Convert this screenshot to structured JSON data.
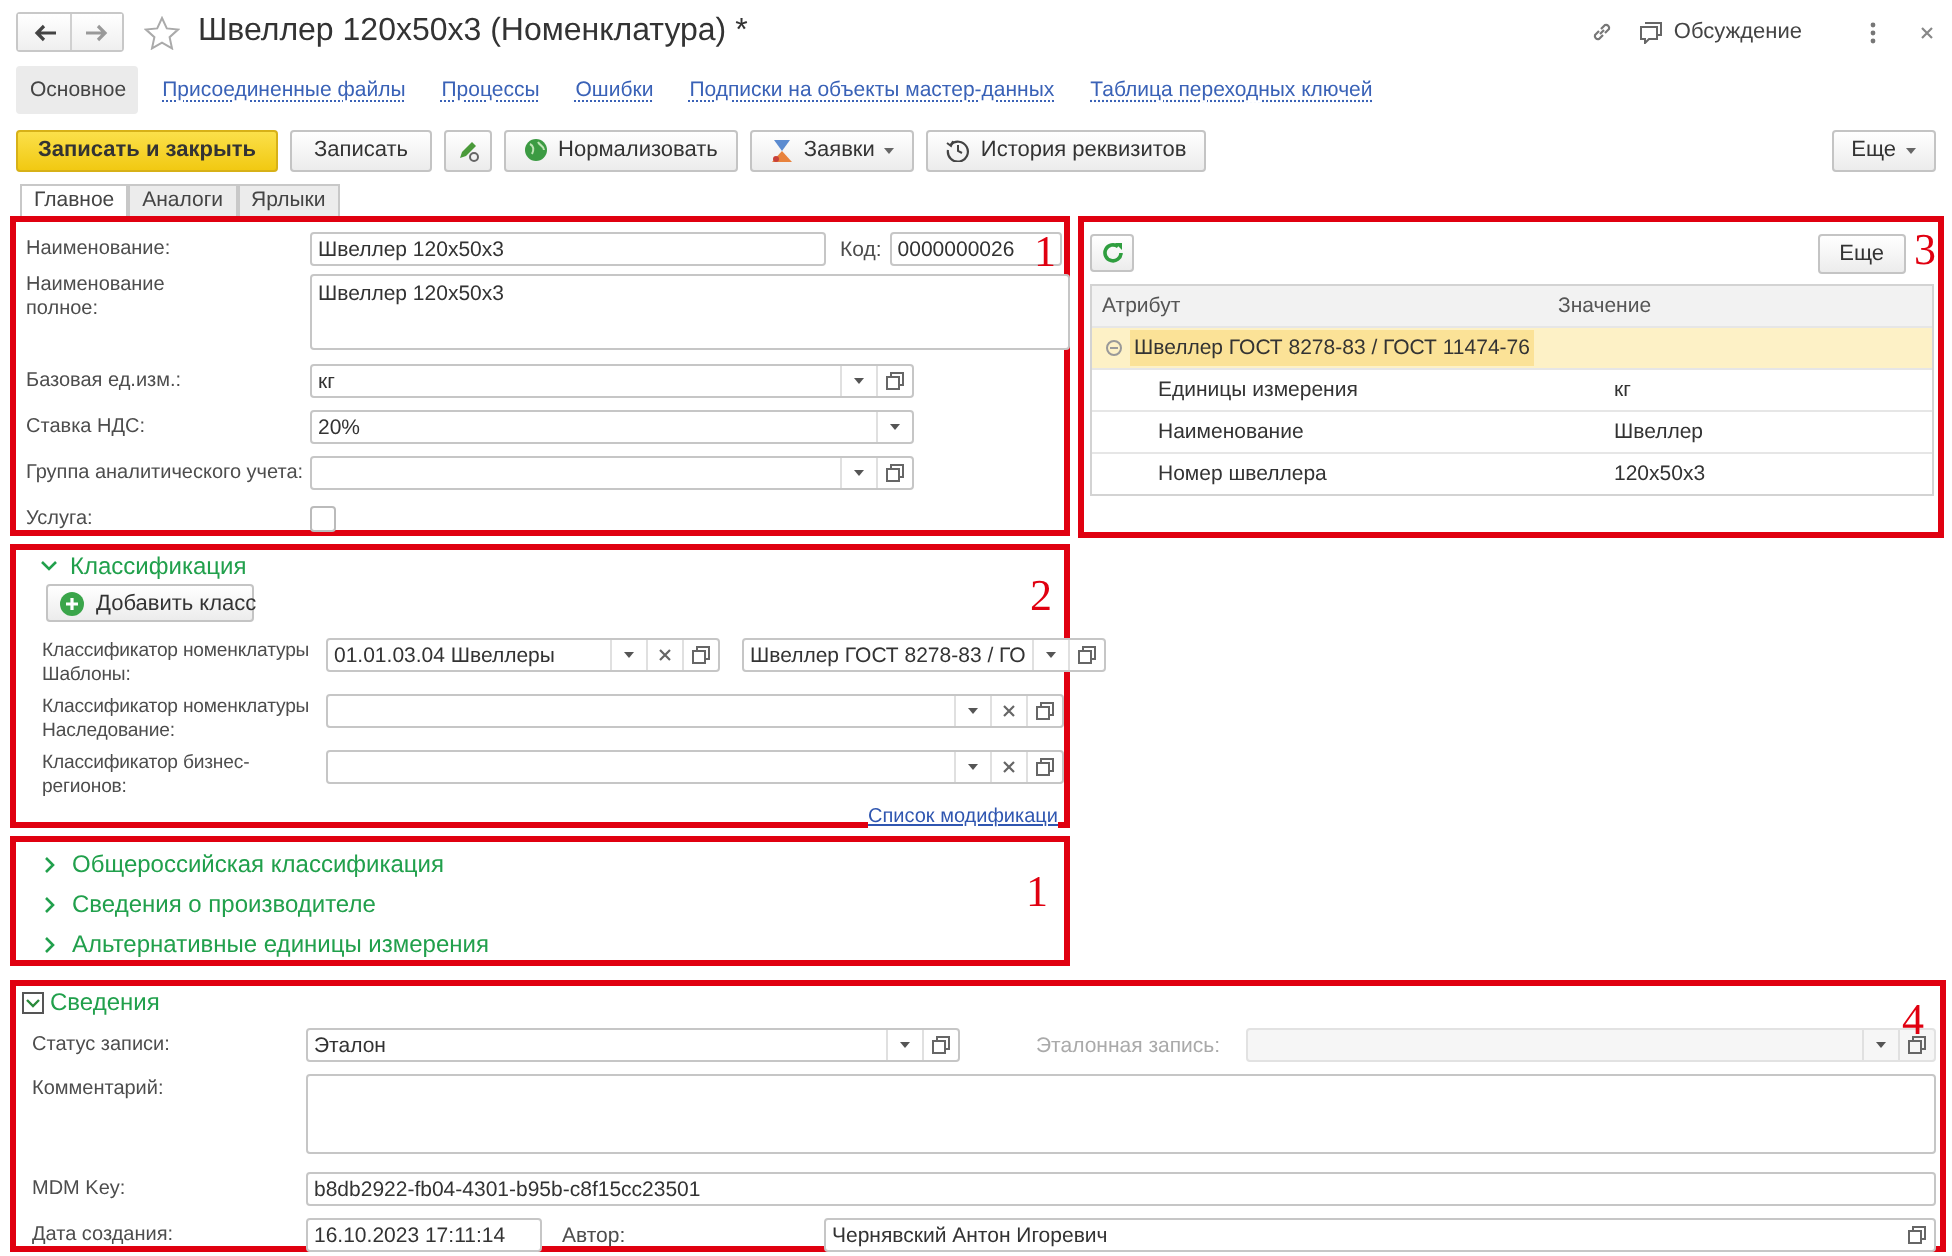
{
  "window": {
    "title": "Швеллер 120x50x3 (Номенклатура) *",
    "discussion": "Обсуждение"
  },
  "nav_tabs": [
    {
      "label": "Основное",
      "selected": true
    },
    {
      "label": "Присоединенные файлы",
      "selected": false
    },
    {
      "label": "Процессы",
      "selected": false
    },
    {
      "label": "Ошибки",
      "selected": false
    },
    {
      "label": "Подписки на объекты мастер-данных",
      "selected": false
    },
    {
      "label": "Таблица переходных ключей",
      "selected": false
    }
  ],
  "toolbar": [
    {
      "kind": "primary",
      "label": "Записать и закрыть"
    },
    {
      "kind": "plain",
      "label": "Записать"
    },
    {
      "kind": "edit"
    },
    {
      "kind": "normalize",
      "label": "Нормализовать"
    },
    {
      "kind": "requests",
      "label": "Заявки"
    },
    {
      "kind": "history",
      "label": "История реквизитов"
    }
  ],
  "more_button": "Еще",
  "form_tabs": [
    {
      "label": "Главное",
      "selected": true
    },
    {
      "label": "Аналоги",
      "selected": false
    },
    {
      "label": "Ярлыки",
      "selected": false
    }
  ],
  "main_section": {
    "marker": "1",
    "fields": [
      {
        "label": "Наименование:",
        "kind": "input",
        "value": "Швеллер 120x50x3"
      },
      {
        "label": "Код:",
        "kind": "input",
        "value": "0000000026"
      },
      {
        "label": "Наименование полное:",
        "kind": "textarea",
        "value": "Швеллер 120x50x3"
      },
      {
        "label": "Базовая ед.изм.:",
        "kind": "select-open",
        "value": "кг"
      },
      {
        "label": "Ставка НДС:",
        "kind": "select",
        "value": "20%"
      },
      {
        "label": "Группа аналитического учета:",
        "kind": "select-open"
      },
      {
        "label": "Услуга:",
        "kind": "checkbox",
        "checked": false
      }
    ]
  },
  "classification": {
    "marker": "2",
    "title": "Классификация",
    "expanded": true,
    "add_button": "Добавить класс",
    "rows": [
      {
        "label": "Классификатор номенклатуры Шаблоны:",
        "fields": [
          {
            "kind": "select-clear-open",
            "value": "01.01.03.04 Швеллеры"
          },
          {
            "kind": "select-open",
            "value": "Швеллер ГОСТ 8278-83 / ГО"
          }
        ]
      },
      {
        "label": "Классификатор номенклатуры Наследование:",
        "fields": [
          {
            "kind": "select-clear-open"
          }
        ]
      },
      {
        "label": "Классификатор бизнес-регионов:",
        "fields": [
          {
            "kind": "select-clear-open"
          }
        ]
      }
    ],
    "link": "Список модификаци"
  },
  "groups": {
    "marker": "1",
    "items": [
      {
        "title": "Общероссийская классификация",
        "expanded": false
      },
      {
        "title": "Сведения о производителе",
        "expanded": false
      },
      {
        "title": "Альтернативные единицы измерения",
        "expanded": false
      }
    ]
  },
  "attributes": {
    "marker": "3",
    "more_button": "Еще",
    "columns": [
      "Атрибут",
      "Значение"
    ],
    "rows": [
      {
        "attribute": "Швеллер ГОСТ 8278-83 / ГОСТ 11474-76",
        "selected": true,
        "expanded": true,
        "children": [
          {
            "attribute": "Единицы измерения",
            "value": "кг",
            "selected": false
          },
          {
            "attribute": "Наименование",
            "value": "Швеллер",
            "selected": false
          },
          {
            "attribute": "Номер швеллера",
            "value": "120x50x3",
            "selected": false
          }
        ]
      }
    ]
  },
  "details": {
    "marker": "4",
    "title": "Сведения",
    "expanded": true,
    "fields": [
      {
        "label": "Статус записи:",
        "kind": "select-open",
        "value": "Эталон",
        "disabled": false
      },
      {
        "label": "Эталонная запись:",
        "kind": "select-open",
        "disabled": true
      },
      {
        "label": "Комментарий:",
        "kind": "textarea",
        "disabled": false
      },
      {
        "label": "MDM Key:",
        "kind": "input",
        "value": "b8db2922-fb04-4301-b95b-c8f15cc23501",
        "disabled": false
      },
      {
        "label": "Дата создания:",
        "kind": "input",
        "value": "16.10.2023 17:11:14",
        "disabled": false
      },
      {
        "label": "Автор:",
        "kind": "input-open",
        "value": "Чернявский Антон Игоревич",
        "disabled": false
      }
    ]
  }
}
